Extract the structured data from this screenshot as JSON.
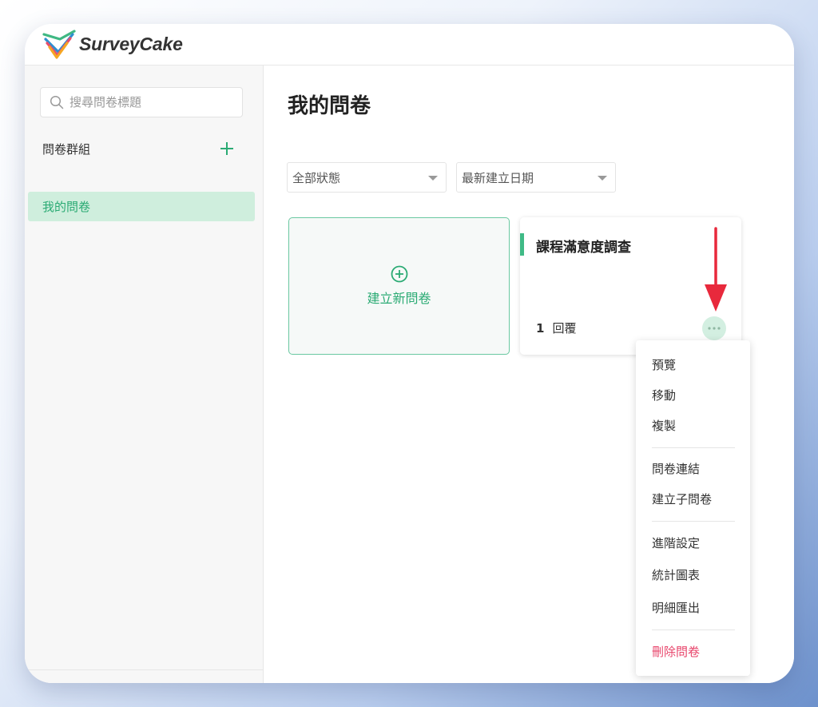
{
  "app": {
    "name": "SurveyCake"
  },
  "sidebar": {
    "search_placeholder": "搜尋問卷標題",
    "group_title": "問卷群組",
    "nav_items": [
      {
        "label": "我的問卷",
        "active": true
      }
    ]
  },
  "main": {
    "title": "我的問卷",
    "filters": {
      "status": "全部狀態",
      "sort": "最新建立日期"
    },
    "new_survey_label": "建立新問卷",
    "surveys": [
      {
        "title": "課程滿意度調查",
        "responses": "1",
        "responses_label": "回覆"
      }
    ]
  },
  "context_menu": {
    "groups": [
      [
        "預覽",
        "移動",
        "複製"
      ],
      [
        "問卷連結",
        "建立子問卷"
      ],
      [
        "進階設定",
        "統計圖表",
        "明細匯出"
      ],
      [
        "刪除問卷"
      ]
    ]
  },
  "colors": {
    "brand_green": "#2bab74",
    "active_bg": "#cfeedd",
    "danger": "#e8456b",
    "annotation_arrow": "#e8293c"
  },
  "icons": {
    "search": "search-icon",
    "add": "plus-icon",
    "more": "ellipsis-icon",
    "create": "plus-circle-icon"
  }
}
